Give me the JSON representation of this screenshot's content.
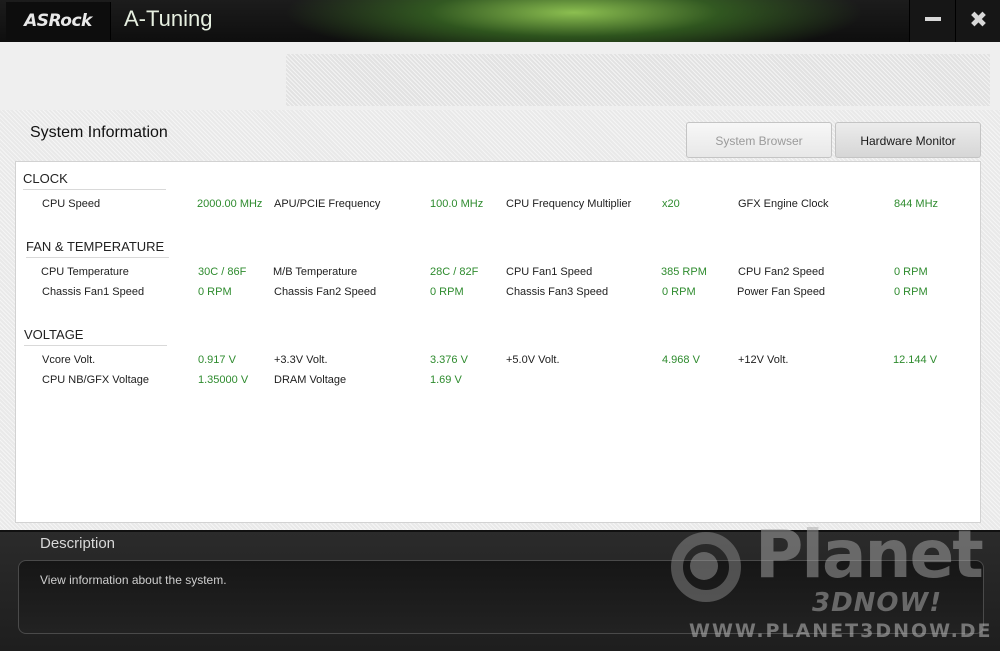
{
  "window": {
    "brand": "ASRock",
    "app_title": "A-Tuning",
    "minimize_icon": "minimize-icon",
    "close_icon": "close-icon",
    "close_glyph": "✖"
  },
  "page": {
    "title": "System Information"
  },
  "tabs": {
    "system_browser": "System Browser",
    "hardware_monitor": "Hardware Monitor",
    "active": "Hardware Monitor"
  },
  "sections": {
    "clock": {
      "title": "CLOCK",
      "items": [
        {
          "label": "CPU Speed",
          "value": "2000.00 MHz"
        },
        {
          "label": "APU/PCIE Frequency",
          "value": "100.0 MHz"
        },
        {
          "label": "CPU Frequency Multiplier",
          "value": "x20"
        },
        {
          "label": "GFX Engine Clock",
          "value": "844 MHz"
        }
      ]
    },
    "fan_temp": {
      "title": "FAN & TEMPERATURE",
      "items": [
        {
          "label": "CPU Temperature",
          "value": "30C / 86F"
        },
        {
          "label": "M/B Temperature",
          "value": "28C / 82F"
        },
        {
          "label": "CPU Fan1 Speed",
          "value": "385 RPM"
        },
        {
          "label": "CPU Fan2 Speed",
          "value": "0 RPM"
        },
        {
          "label": "Chassis Fan1 Speed",
          "value": "0 RPM"
        },
        {
          "label": "Chassis Fan2 Speed",
          "value": "0 RPM"
        },
        {
          "label": "Chassis Fan3 Speed",
          "value": "0 RPM"
        },
        {
          "label": "Power Fan Speed",
          "value": "0 RPM"
        }
      ]
    },
    "voltage": {
      "title": "VOLTAGE",
      "items": [
        {
          "label": "Vcore Volt.",
          "value": "0.917 V"
        },
        {
          "label": "+3.3V Volt.",
          "value": "3.376 V"
        },
        {
          "label": "+5.0V Volt.",
          "value": "4.968 V"
        },
        {
          "label": "+12V Volt.",
          "value": "12.144 V"
        },
        {
          "label": "CPU NB/GFX Voltage",
          "value": "1.35000 V"
        },
        {
          "label": "DRAM Voltage",
          "value": "1.69 V"
        }
      ]
    }
  },
  "description": {
    "title": "Description",
    "text": "View information about the system."
  },
  "watermark": {
    "main": "Planet",
    "sub": "3DNOW!",
    "url": "WWW.PLANET3DNOW.DE"
  },
  "colors": {
    "value_green": "#2e8b2e",
    "accent_green": "#7fc24a"
  }
}
